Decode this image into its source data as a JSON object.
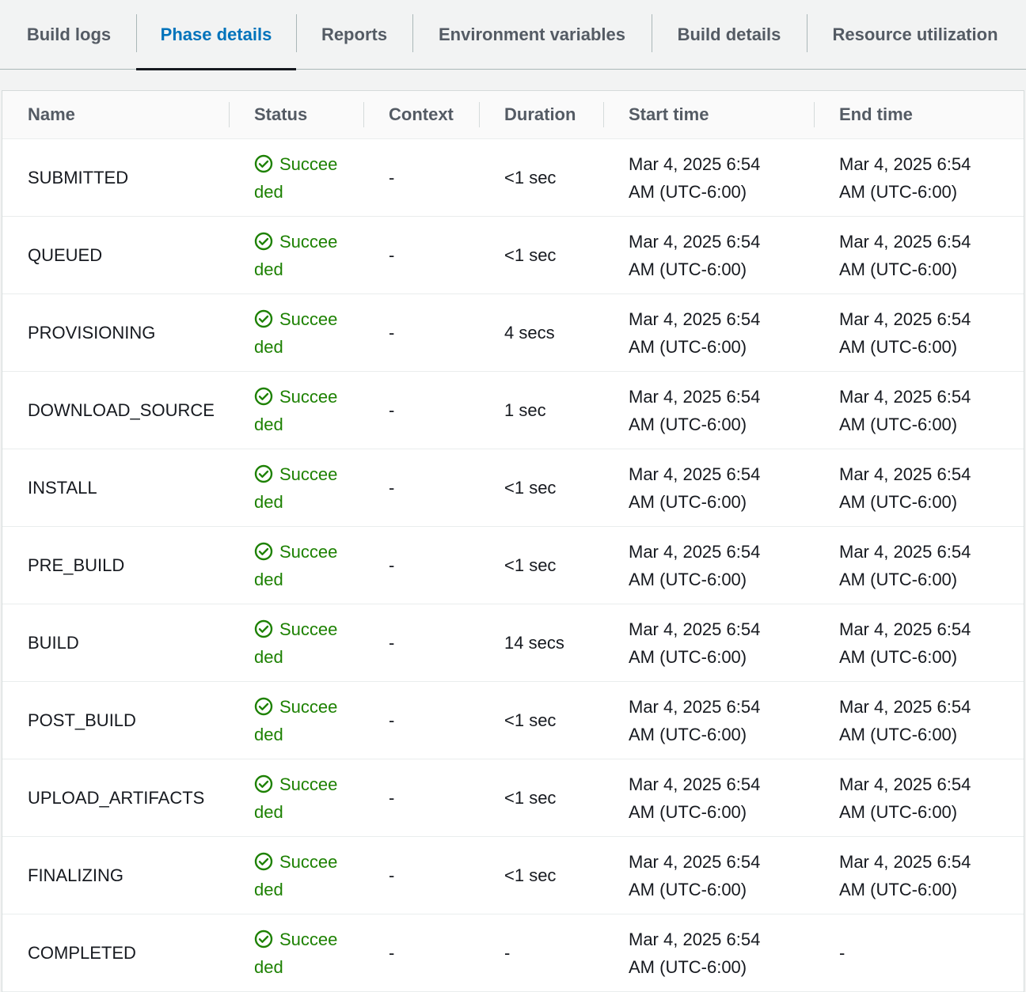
{
  "tabs": [
    {
      "label": "Build logs"
    },
    {
      "label": "Phase details"
    },
    {
      "label": "Reports"
    },
    {
      "label": "Environment variables"
    },
    {
      "label": "Build details"
    },
    {
      "label": "Resource utilization"
    }
  ],
  "active_tab": "Phase details",
  "table": {
    "columns": [
      "Name",
      "Status",
      "Context",
      "Duration",
      "Start time",
      "End time"
    ],
    "rows": [
      {
        "name": "SUBMITTED",
        "status_line1": "Succee",
        "status_line2": "ded",
        "context": "-",
        "duration": "<1 sec",
        "start_line1": "Mar 4, 2025 6:54",
        "start_line2": "AM (UTC-6:00)",
        "end_line1": "Mar 4, 2025 6:54",
        "end_line2": "AM (UTC-6:00)"
      },
      {
        "name": "QUEUED",
        "status_line1": "Succee",
        "status_line2": "ded",
        "context": "-",
        "duration": "<1 sec",
        "start_line1": "Mar 4, 2025 6:54",
        "start_line2": "AM (UTC-6:00)",
        "end_line1": "Mar 4, 2025 6:54",
        "end_line2": "AM (UTC-6:00)"
      },
      {
        "name": "PROVISIONING",
        "status_line1": "Succee",
        "status_line2": "ded",
        "context": "-",
        "duration": "4 secs",
        "start_line1": "Mar 4, 2025 6:54",
        "start_line2": "AM (UTC-6:00)",
        "end_line1": "Mar 4, 2025 6:54",
        "end_line2": "AM (UTC-6:00)"
      },
      {
        "name": "DOWNLOAD_SOURCE",
        "status_line1": "Succee",
        "status_line2": "ded",
        "context": "-",
        "duration": "1 sec",
        "start_line1": "Mar 4, 2025 6:54",
        "start_line2": "AM (UTC-6:00)",
        "end_line1": "Mar 4, 2025 6:54",
        "end_line2": "AM (UTC-6:00)"
      },
      {
        "name": "INSTALL",
        "status_line1": "Succee",
        "status_line2": "ded",
        "context": "-",
        "duration": "<1 sec",
        "start_line1": "Mar 4, 2025 6:54",
        "start_line2": "AM (UTC-6:00)",
        "end_line1": "Mar 4, 2025 6:54",
        "end_line2": "AM (UTC-6:00)"
      },
      {
        "name": "PRE_BUILD",
        "status_line1": "Succee",
        "status_line2": "ded",
        "context": "-",
        "duration": "<1 sec",
        "start_line1": "Mar 4, 2025 6:54",
        "start_line2": "AM (UTC-6:00)",
        "end_line1": "Mar 4, 2025 6:54",
        "end_line2": "AM (UTC-6:00)"
      },
      {
        "name": "BUILD",
        "status_line1": "Succee",
        "status_line2": "ded",
        "context": "-",
        "duration": "14 secs",
        "start_line1": "Mar 4, 2025 6:54",
        "start_line2": "AM (UTC-6:00)",
        "end_line1": "Mar 4, 2025 6:54",
        "end_line2": "AM (UTC-6:00)"
      },
      {
        "name": "POST_BUILD",
        "status_line1": "Succee",
        "status_line2": "ded",
        "context": "-",
        "duration": "<1 sec",
        "start_line1": "Mar 4, 2025 6:54",
        "start_line2": "AM (UTC-6:00)",
        "end_line1": "Mar 4, 2025 6:54",
        "end_line2": "AM (UTC-6:00)"
      },
      {
        "name": "UPLOAD_ARTIFACTS",
        "status_line1": "Succee",
        "status_line2": "ded",
        "context": "-",
        "duration": "<1 sec",
        "start_line1": "Mar 4, 2025 6:54",
        "start_line2": "AM (UTC-6:00)",
        "end_line1": "Mar 4, 2025 6:54",
        "end_line2": "AM (UTC-6:00)"
      },
      {
        "name": "FINALIZING",
        "status_line1": "Succee",
        "status_line2": "ded",
        "context": "-",
        "duration": "<1 sec",
        "start_line1": "Mar 4, 2025 6:54",
        "start_line2": "AM (UTC-6:00)",
        "end_line1": "Mar 4, 2025 6:54",
        "end_line2": "AM (UTC-6:00)"
      },
      {
        "name": "COMPLETED",
        "status_line1": "Succee",
        "status_line2": "ded",
        "context": "-",
        "duration": "-",
        "start_line1": "Mar 4, 2025 6:54",
        "start_line2": "AM (UTC-6:00)",
        "end_line1": "-",
        "end_line2": ""
      }
    ]
  },
  "icons": {
    "status_icon": "check-circle-icon"
  },
  "colors": {
    "active_tab": "#0073bb",
    "success": "#1d8102",
    "header_text": "#545b64"
  }
}
